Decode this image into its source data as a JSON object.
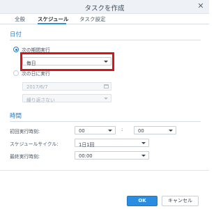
{
  "window": {
    "title": "タスクを作成"
  },
  "tabs": [
    {
      "label": "全般"
    },
    {
      "label": "スケジュール"
    },
    {
      "label": "タスク設定"
    }
  ],
  "date_section": {
    "title": "日付",
    "option_periodic": {
      "label": "次の期間実行",
      "checked": true
    },
    "frequency_select": {
      "value": "毎日"
    },
    "option_once": {
      "label": "次の日に実行",
      "checked": false
    },
    "date_input": {
      "value": "2017/6/7"
    },
    "repeat_select": {
      "value": "繰り返さない"
    }
  },
  "time_section": {
    "title": "時間",
    "first_run": {
      "label": "初回実行時刻:",
      "hour": "00",
      "minute": "00"
    },
    "cycle": {
      "label": "スケジュールサイクル:",
      "value": "1日1回"
    },
    "last_run": {
      "label": "最終実行時刻:",
      "value": "00:00"
    }
  },
  "footer": {
    "ok_label": "OK",
    "cancel_label": "キャンセル"
  },
  "colors": {
    "accent": "#2b8de0",
    "highlight": "#d81414",
    "section_title": "#2b7bc4"
  }
}
